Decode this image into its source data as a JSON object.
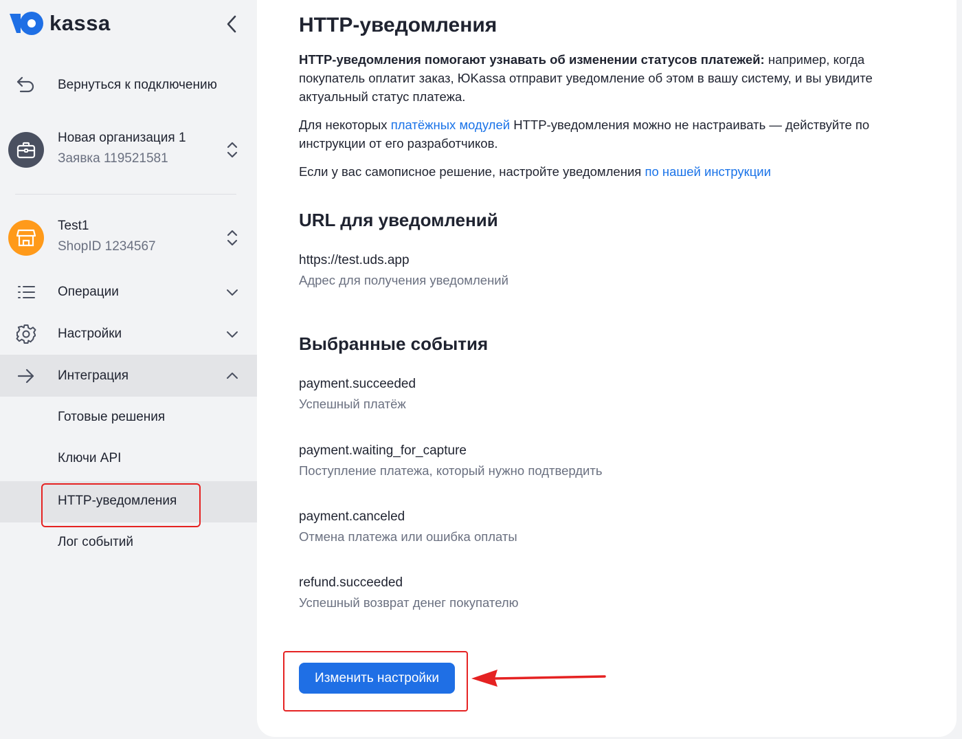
{
  "brand": {
    "logo_text": "kassa"
  },
  "sidebar": {
    "back_label": "Вернуться к подключению",
    "org": {
      "name": "Новая организация 1",
      "subtitle": "Заявка 119521581"
    },
    "shop": {
      "name": "Test1",
      "subtitle": "ShopID 1234567"
    },
    "menu": [
      {
        "label": "Операции",
        "icon": "list-icon",
        "state": "collapsed"
      },
      {
        "label": "Настройки",
        "icon": "gear-icon",
        "state": "collapsed"
      },
      {
        "label": "Интеграция",
        "icon": "arrow-right-icon",
        "state": "expanded"
      }
    ],
    "submenu": [
      {
        "label": "Готовые решения"
      },
      {
        "label": "Ключи API"
      },
      {
        "label": "HTTP-уведомления",
        "active": true
      },
      {
        "label": "Лог событий"
      }
    ]
  },
  "main": {
    "title": "HTTP-уведомления",
    "intro_bold": "HTTP-уведомления помогают узнавать об изменении статусов платежей:",
    "intro_rest": " например, когда покупатель оплатит заказ, ЮKassa отправит уведомление об этом в вашу систему, и вы увидите актуальный статус платежа.",
    "modules_before": "Для некоторых ",
    "modules_link": "платёжных модулей",
    "modules_after": " HTTP-уведомления можно не настраивать — действуйте по инструкции от его разработчиков.",
    "custom_before": "Если у вас самописное решение, настройте уведомления ",
    "custom_link": "по нашей инструкции",
    "url_section_title": "URL для уведомлений",
    "url_value": "https://test.uds.app",
    "url_caption": "Адрес для получения уведомлений",
    "events_title": "Выбранные события",
    "events": [
      {
        "name": "payment.succeeded",
        "desc": "Успешный платёж"
      },
      {
        "name": "payment.waiting_for_capture",
        "desc": "Поступление платежа, который нужно подтвердить"
      },
      {
        "name": "payment.canceled",
        "desc": "Отмена платежа или ошибка оплаты"
      },
      {
        "name": "refund.succeeded",
        "desc": "Успешный возврат денег покупателю"
      }
    ],
    "edit_button": "Изменить настройки"
  },
  "colors": {
    "accent": "#1f6fe5",
    "link": "#1a73e8",
    "highlight": "#e52222",
    "shop_avatar": "#ff9a1a",
    "org_avatar": "#4a5060"
  }
}
